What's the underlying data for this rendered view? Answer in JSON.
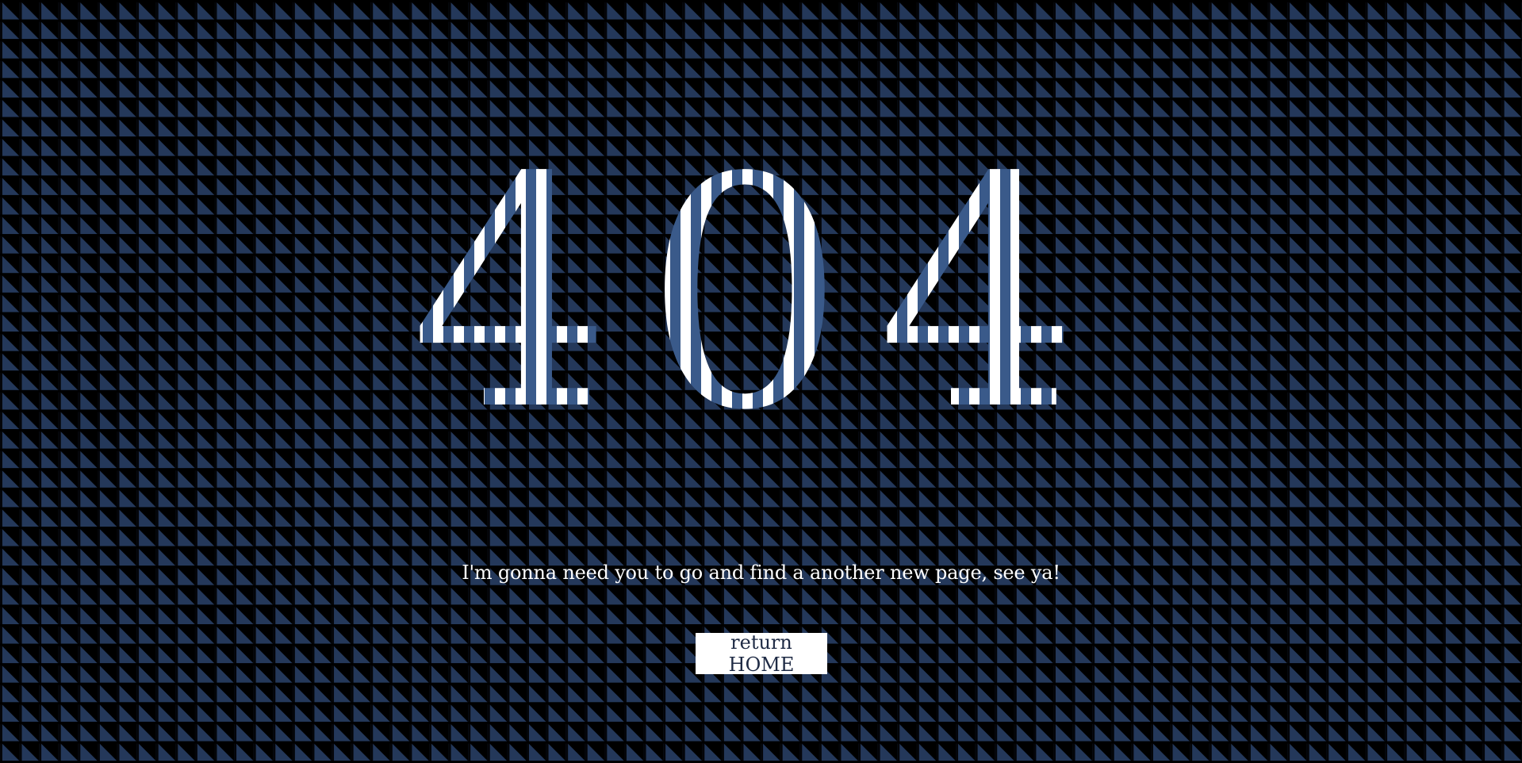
{
  "error": {
    "code": "404",
    "message": "I'm gonna need you to go and find a another new page, see ya!"
  },
  "actions": {
    "home_label": "return HOME"
  },
  "colors": {
    "background": "#000000",
    "pattern": "#24385a",
    "stripe_dark": "#3a5a8a",
    "stripe_light": "#ffffff",
    "text": "#ffffff",
    "button_bg": "#ffffff",
    "button_text": "#1e2a44"
  }
}
